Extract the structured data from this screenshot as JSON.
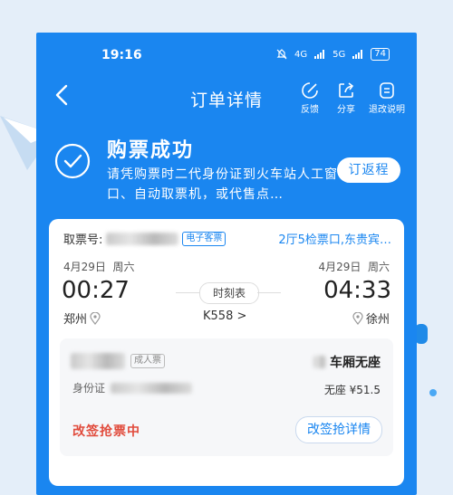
{
  "status_bar": {
    "time": "19:16",
    "signal1": "4G",
    "signal2": "5G",
    "battery": "74"
  },
  "nav": {
    "title": "订单详情",
    "actions": [
      {
        "label": "反馈",
        "icon": "feedback-icon"
      },
      {
        "label": "分享",
        "icon": "share-icon"
      },
      {
        "label": "退改说明",
        "icon": "info-icon"
      }
    ]
  },
  "success": {
    "heading": "购票成功",
    "description": "请凭购票时二代身份证到火车站人工窗口、自动取票机，或代售点…",
    "rebook_button": "订返程"
  },
  "ticket": {
    "pickup_label": "取票号:",
    "e_ticket_tag": "电子客票",
    "gate": "2厅5检票口,东贵宾…",
    "departure": {
      "date": "4月29日",
      "weekday": "周六",
      "time": "00:27",
      "station": "郑州"
    },
    "arrival": {
      "date": "4月29日",
      "weekday": "周六",
      "time": "04:33",
      "station": "徐州"
    },
    "schedule_label": "时刻表",
    "train_no": "K558 >"
  },
  "passenger": {
    "ticket_type": "成人票",
    "id_label": "身份证",
    "carriage": "车厢无座",
    "seat_price": "无座 ¥51.5",
    "status": "改签抢票中",
    "detail_button": "改签抢详情"
  },
  "colors": {
    "primary": "#1a86f0",
    "alert": "#e14b3c"
  }
}
